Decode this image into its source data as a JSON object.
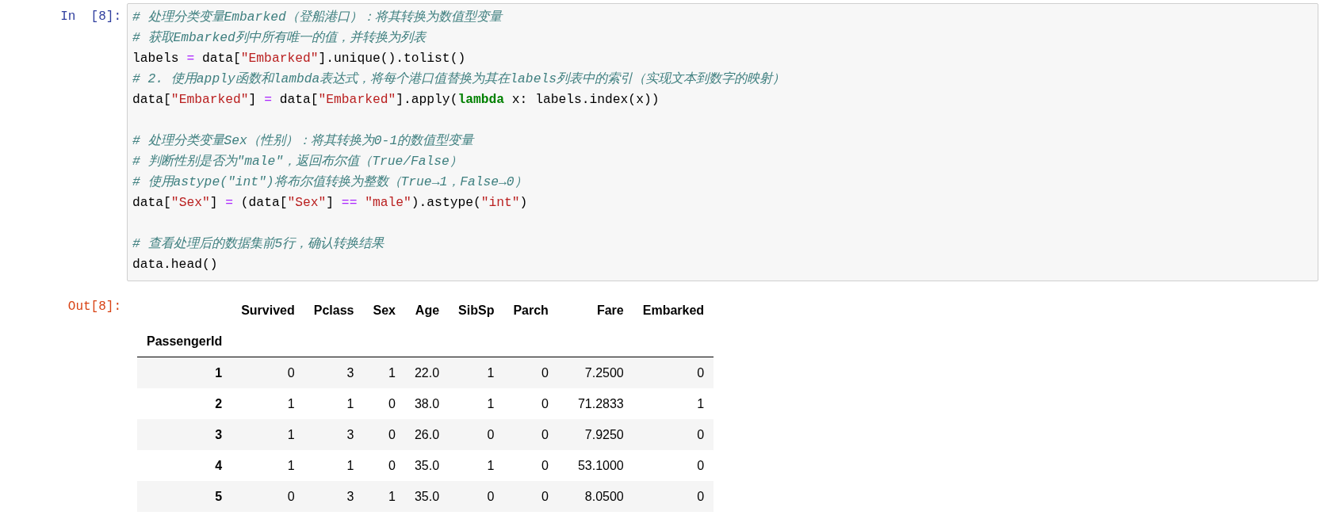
{
  "input_cell": {
    "prompt": "In  [8]:",
    "lines": [
      {
        "kind": "code",
        "tokens": [
          {
            "kind": "comment",
            "text": "# 处理分类变量Embarked（登船港口）：将其转换为数值型变量"
          }
        ]
      },
      {
        "kind": "code",
        "tokens": [
          {
            "kind": "comment",
            "text": "# 获取Embarked列中所有唯一的值，并转换为列表"
          }
        ]
      },
      {
        "kind": "code",
        "tokens": [
          {
            "kind": "plain",
            "text": "labels "
          },
          {
            "kind": "op",
            "text": "="
          },
          {
            "kind": "plain",
            "text": " data["
          },
          {
            "kind": "string",
            "text": "\"Embarked\""
          },
          {
            "kind": "plain",
            "text": "].unique().tolist()"
          }
        ]
      },
      {
        "kind": "code",
        "tokens": [
          {
            "kind": "comment",
            "text": "# 2. 使用apply函数和lambda表达式，将每个港口值替换为其在labels列表中的索引（实现文本到数字的映射）"
          }
        ]
      },
      {
        "kind": "code",
        "tokens": [
          {
            "kind": "plain",
            "text": "data["
          },
          {
            "kind": "string",
            "text": "\"Embarked\""
          },
          {
            "kind": "plain",
            "text": "] "
          },
          {
            "kind": "op",
            "text": "="
          },
          {
            "kind": "plain",
            "text": " data["
          },
          {
            "kind": "string",
            "text": "\"Embarked\""
          },
          {
            "kind": "plain",
            "text": "].apply("
          },
          {
            "kind": "keyword",
            "text": "lambda"
          },
          {
            "kind": "plain",
            "text": " x: labels.index(x))"
          }
        ]
      },
      {
        "kind": "blank"
      },
      {
        "kind": "code",
        "tokens": [
          {
            "kind": "comment",
            "text": "# 处理分类变量Sex（性别）：将其转换为0-1的数值型变量"
          }
        ]
      },
      {
        "kind": "code",
        "tokens": [
          {
            "kind": "comment",
            "text": "# 判断性别是否为\"male\"，返回布尔值（True/False）"
          }
        ]
      },
      {
        "kind": "code",
        "tokens": [
          {
            "kind": "comment",
            "text": "# 使用astype(\"int\")将布尔值转换为整数（True→1，False→0）"
          }
        ]
      },
      {
        "kind": "code",
        "tokens": [
          {
            "kind": "plain",
            "text": "data["
          },
          {
            "kind": "string",
            "text": "\"Sex\""
          },
          {
            "kind": "plain",
            "text": "] "
          },
          {
            "kind": "op",
            "text": "="
          },
          {
            "kind": "plain",
            "text": " (data["
          },
          {
            "kind": "string",
            "text": "\"Sex\""
          },
          {
            "kind": "plain",
            "text": "] "
          },
          {
            "kind": "op",
            "text": "=="
          },
          {
            "kind": "string",
            "text": " \"male\""
          },
          {
            "kind": "plain",
            "text": ").astype("
          },
          {
            "kind": "string",
            "text": "\"int\""
          },
          {
            "kind": "plain",
            "text": ")"
          }
        ]
      },
      {
        "kind": "blank"
      },
      {
        "kind": "code",
        "tokens": [
          {
            "kind": "comment",
            "text": "# 查看处理后的数据集前5行，确认转换结果"
          }
        ]
      },
      {
        "kind": "code",
        "tokens": [
          {
            "kind": "plain",
            "text": "data.head()"
          }
        ]
      }
    ]
  },
  "output_cell": {
    "prompt": "Out[8]:",
    "table": {
      "columns": [
        "Survived",
        "Pclass",
        "Sex",
        "Age",
        "SibSp",
        "Parch",
        "Fare",
        "Embarked"
      ],
      "index_name": "PassengerId",
      "rows": [
        {
          "index": "1",
          "cells": [
            "0",
            "3",
            "1",
            "22.0",
            "1",
            "0",
            "7.2500",
            "0"
          ]
        },
        {
          "index": "2",
          "cells": [
            "1",
            "1",
            "0",
            "38.0",
            "1",
            "0",
            "71.2833",
            "1"
          ]
        },
        {
          "index": "3",
          "cells": [
            "1",
            "3",
            "0",
            "26.0",
            "0",
            "0",
            "7.9250",
            "0"
          ]
        },
        {
          "index": "4",
          "cells": [
            "1",
            "1",
            "0",
            "35.0",
            "1",
            "0",
            "53.1000",
            "0"
          ]
        },
        {
          "index": "5",
          "cells": [
            "0",
            "3",
            "1",
            "35.0",
            "0",
            "0",
            "8.0500",
            "0"
          ]
        }
      ]
    }
  }
}
